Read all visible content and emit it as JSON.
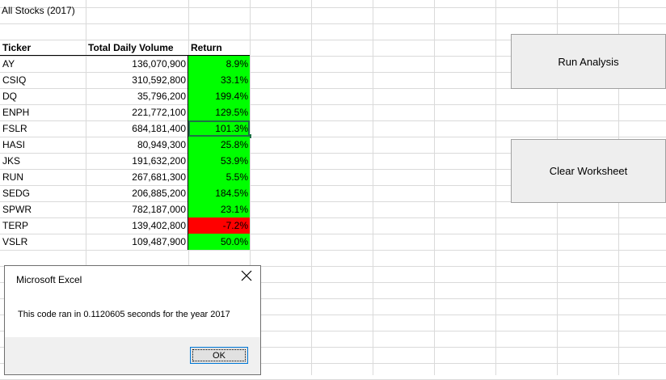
{
  "sheet": {
    "title": "All Stocks (2017)",
    "headers": {
      "ticker": "Ticker",
      "volume": "Total Daily Volume",
      "return": "Return"
    },
    "rows": [
      {
        "ticker": "AY",
        "volume": "136,070,900",
        "return": "8.9%",
        "status": "positive"
      },
      {
        "ticker": "CSIQ",
        "volume": "310,592,800",
        "return": "33.1%",
        "status": "positive"
      },
      {
        "ticker": "DQ",
        "volume": "35,796,200",
        "return": "199.4%",
        "status": "positive"
      },
      {
        "ticker": "ENPH",
        "volume": "221,772,100",
        "return": "129.5%",
        "status": "positive"
      },
      {
        "ticker": "FSLR",
        "volume": "684,181,400",
        "return": "101.3%",
        "status": "positive"
      },
      {
        "ticker": "HASI",
        "volume": "80,949,300",
        "return": "25.8%",
        "status": "positive"
      },
      {
        "ticker": "JKS",
        "volume": "191,632,200",
        "return": "53.9%",
        "status": "positive"
      },
      {
        "ticker": "RUN",
        "volume": "267,681,300",
        "return": "5.5%",
        "status": "positive"
      },
      {
        "ticker": "SEDG",
        "volume": "206,885,200",
        "return": "184.5%",
        "status": "positive"
      },
      {
        "ticker": "SPWR",
        "volume": "782,187,000",
        "return": "23.1%",
        "status": "positive"
      },
      {
        "ticker": "TERP",
        "volume": "139,402,800",
        "return": "-7.2%",
        "status": "negative"
      },
      {
        "ticker": "VSLR",
        "volume": "109,487,900",
        "return": "50.0%",
        "status": "positive"
      }
    ],
    "selected_ticker": "FSLR"
  },
  "colors": {
    "positive": "#00ff00",
    "negative": "#ff0000",
    "selection": "#1e7145",
    "gridline": "#dadada"
  },
  "buttons": {
    "run_analysis": "Run Analysis",
    "clear_worksheet": "Clear Worksheet"
  },
  "dialog": {
    "title": "Microsoft Excel",
    "close_icon": "close-icon",
    "message": "This code ran in 0.1120605 seconds for the year 2017",
    "ok_label": "OK"
  }
}
